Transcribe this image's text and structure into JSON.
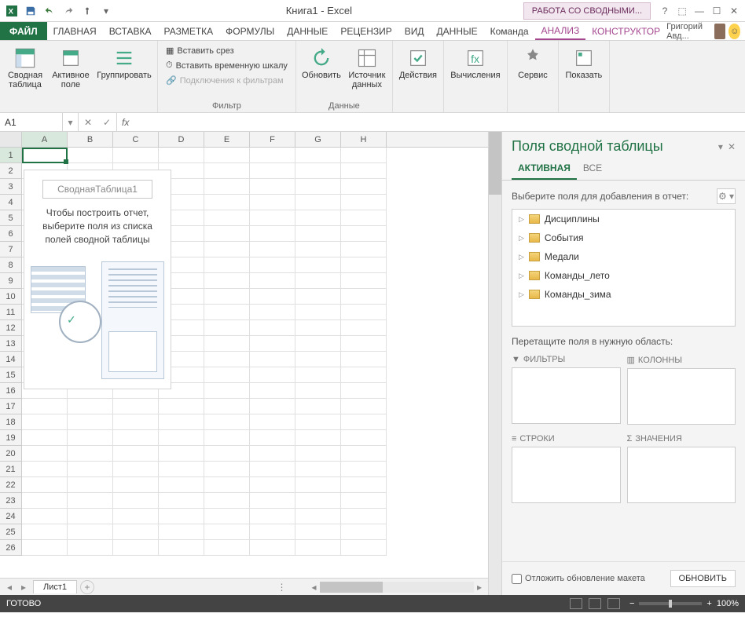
{
  "title": "Книга1 - Excel",
  "ctxTab": "РАБОТА СО СВОДНЫМИ...",
  "user": "Григорий Авд...",
  "tabs": {
    "file": "ФАЙЛ",
    "home": "ГЛАВНАЯ",
    "insert": "ВСТАВКА",
    "layout": "РАЗМЕТКА",
    "formulas": "ФОРМУЛЫ",
    "data1": "ДАННЫЕ",
    "review": "РЕЦЕНЗИР",
    "view": "ВИД",
    "data2": "ДАННЫЕ",
    "team": "Команда",
    "analyze": "АНАЛИЗ",
    "design": "КОНСТРУКТОР"
  },
  "ribbon": {
    "pivotTable": "Сводная\nтаблица",
    "activeField": "Активное\nполе",
    "group": "Группировать",
    "insertSlicer": "Вставить срез",
    "insertTimeline": "Вставить временную шкалу",
    "filterConns": "Подключения к фильтрам",
    "filterGroup": "Фильтр",
    "refresh": "Обновить",
    "dataSource": "Источник\nданных",
    "dataGroup": "Данные",
    "actions": "Действия",
    "calcs": "Вычисления",
    "tools": "Сервис",
    "show": "Показать"
  },
  "nameBox": "A1",
  "fx": "fx",
  "cols": [
    "A",
    "B",
    "C",
    "D",
    "E",
    "F",
    "G",
    "H"
  ],
  "rows": [
    "1",
    "2",
    "3",
    "4",
    "5",
    "6",
    "7",
    "8",
    "9",
    "10",
    "11",
    "12",
    "13",
    "14",
    "15",
    "16",
    "17",
    "18",
    "19",
    "20",
    "21",
    "22",
    "23",
    "24",
    "25",
    "26"
  ],
  "pivotPh": {
    "title": "СводнаяТаблица1",
    "text": "Чтобы построить отчет, выберите поля из списка полей сводной таблицы"
  },
  "sheetTab": "Лист1",
  "status": "ГОТОВО",
  "zoom": "100%",
  "panel": {
    "title": "Поля сводной таблицы",
    "tabActive": "АКТИВНАЯ",
    "tabAll": "ВСЕ",
    "instr": "Выберите поля для добавления в отчет:",
    "fields": [
      "Дисциплины",
      "События",
      "Медали",
      "Команды_лето",
      "Команды_зима"
    ],
    "dragInstr": "Перетащите поля в нужную область:",
    "filters": "ФИЛЬТРЫ",
    "columns": "КОЛОННЫ",
    "rowsA": "СТРОКИ",
    "values": "ЗНАЧЕНИЯ",
    "defer": "Отложить обновление макета",
    "update": "ОБНОВИТЬ"
  }
}
